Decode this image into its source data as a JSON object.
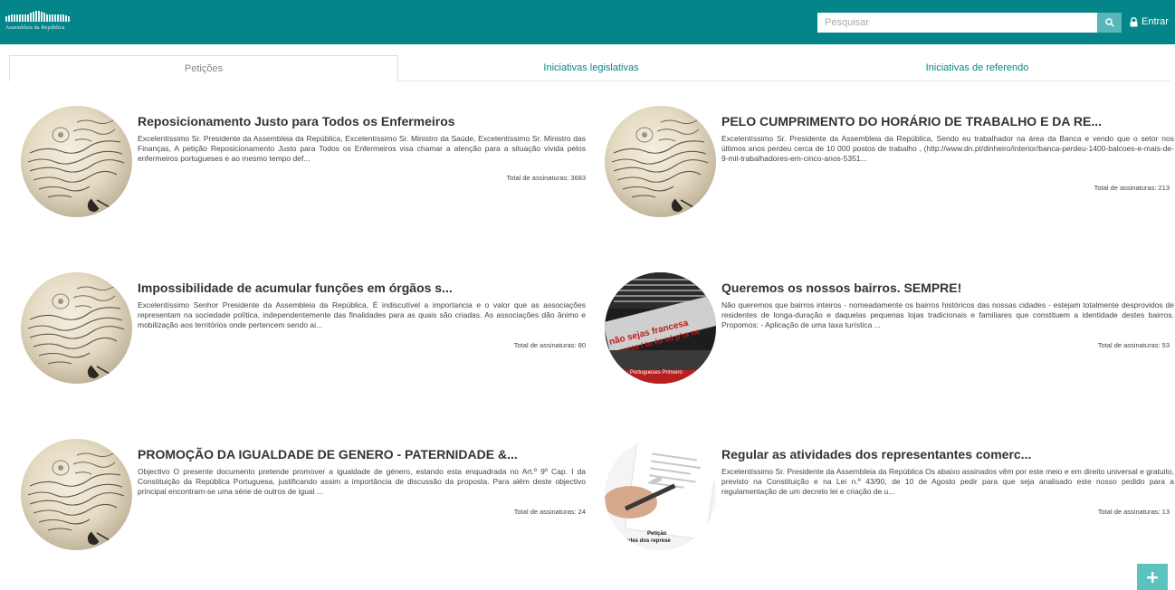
{
  "header": {
    "logo_text": "Assembleia da República",
    "search_placeholder": "Pesquisar",
    "login_label": "Entrar"
  },
  "tabs": [
    {
      "label": "Petições",
      "active": true
    },
    {
      "label": "Iniciativas legislativas",
      "active": false
    },
    {
      "label": "Iniciativas de referendo",
      "active": false
    }
  ],
  "petitions": [
    {
      "title": "Reposicionamento Justo para Todos os Enfermeiros",
      "description": "Excelentíssimo Sr. Presidente da Assembleia da República, Excelentíssimo Sr. Ministro da Saúde, Excelentíssimo Sr. Ministro das Finanças, A petição Reposicionamento Justo para Todos os Enfermeiros visa chamar a atenção para a situação vivida pelos enfermeiros portugueses e ao mesmo tempo def...",
      "total": "Total de assinaturas: 3683",
      "image": "manuscript"
    },
    {
      "title": "PELO CUMPRIMENTO DO HORÁRIO DE TRABALHO E DA RE...",
      "description": "Excelentíssimo Sr. Presidente da Assembleia da República, Sendo eu trabalhador na área da Banca e vendo que o setor nos últimos anos perdeu cerca de 10 000 postos de trabalho , (http://www.dn.pt/dinheiro/interior/banca-perdeu-1400-balcoes-e-mais-de-9-mil-trabalhadores-em-cinco-anos-5351...",
      "total": "Total de assinaturas: 213",
      "image": "manuscript"
    },
    {
      "title": "Impossibilidade de acumular funções em órgãos s...",
      "description": "Excelentíssimo Senhor Presidente da Assembleia da República, É indiscutível a importancia e o valor que as associações representam na sociedade política, independentemente das finalidades para as quais são criadas. As associações dão ânimo e mobilização aos territórios onde pertencem sendo ai...",
      "total": "Total de assinaturas: 80",
      "image": "manuscript"
    },
    {
      "title": "Queremos os nossos bairros. SEMPRE!",
      "description": "Não queremos que bairros inteiros - nomeadamente os bairros históricos das nossas cidades - estejam totalmente desprovidos de residentes de longa-duração e daquelas pequenas lojas tradicionais e familiares que constituem a identidade destes bairros. Propomos: - Aplicação de uma taxa turística ...",
      "total": "Total de assinaturas: 53",
      "image": "protest",
      "image_text_1": "não sejas francesa",
      "image_text_2": "tuguesa / tu és só p'ra ne",
      "image_text_3": "Portugueses Primeiro"
    },
    {
      "title": "PROMOÇÃO DA IGUALDADE DE GENERO - PATERNIDADE &...",
      "description": "Objectivo O presente documento pretende promover a igualdade de género, estando esta enquadrada no Art.º 9º Cap. I da Constituição da República Portuguesa, justificando assim a importância de discussão da proposta. Para além deste objectivo principal encontram-se uma série de outros de igual ...",
      "total": "Total de assinaturas: 24",
      "image": "manuscript"
    },
    {
      "title": "Regular as atividades dos representantes comerc...",
      "description": "Excelentíssimo Sr. Presidente da Assembleia da República Os abaixo assinados vêm por este meio e em direito universal e gratuito, previsto na Constituição e na Lei n.º 43/90, de 10 de Agosto pedir para que seja analisado este nosso pedido para a regulamentação de um decreto lei e criação de u...",
      "total": "Total de assinaturas: 13",
      "image": "petition-pen",
      "image_text_1": "Petição",
      "image_text_2": "idades dos represe"
    }
  ],
  "colors": {
    "primary": "#04858a",
    "search_button": "#58b6ba",
    "fab": "#5bc2bd"
  },
  "icons": {
    "search": "search-icon",
    "login": "lock-icon",
    "fab": "plus-icon"
  }
}
